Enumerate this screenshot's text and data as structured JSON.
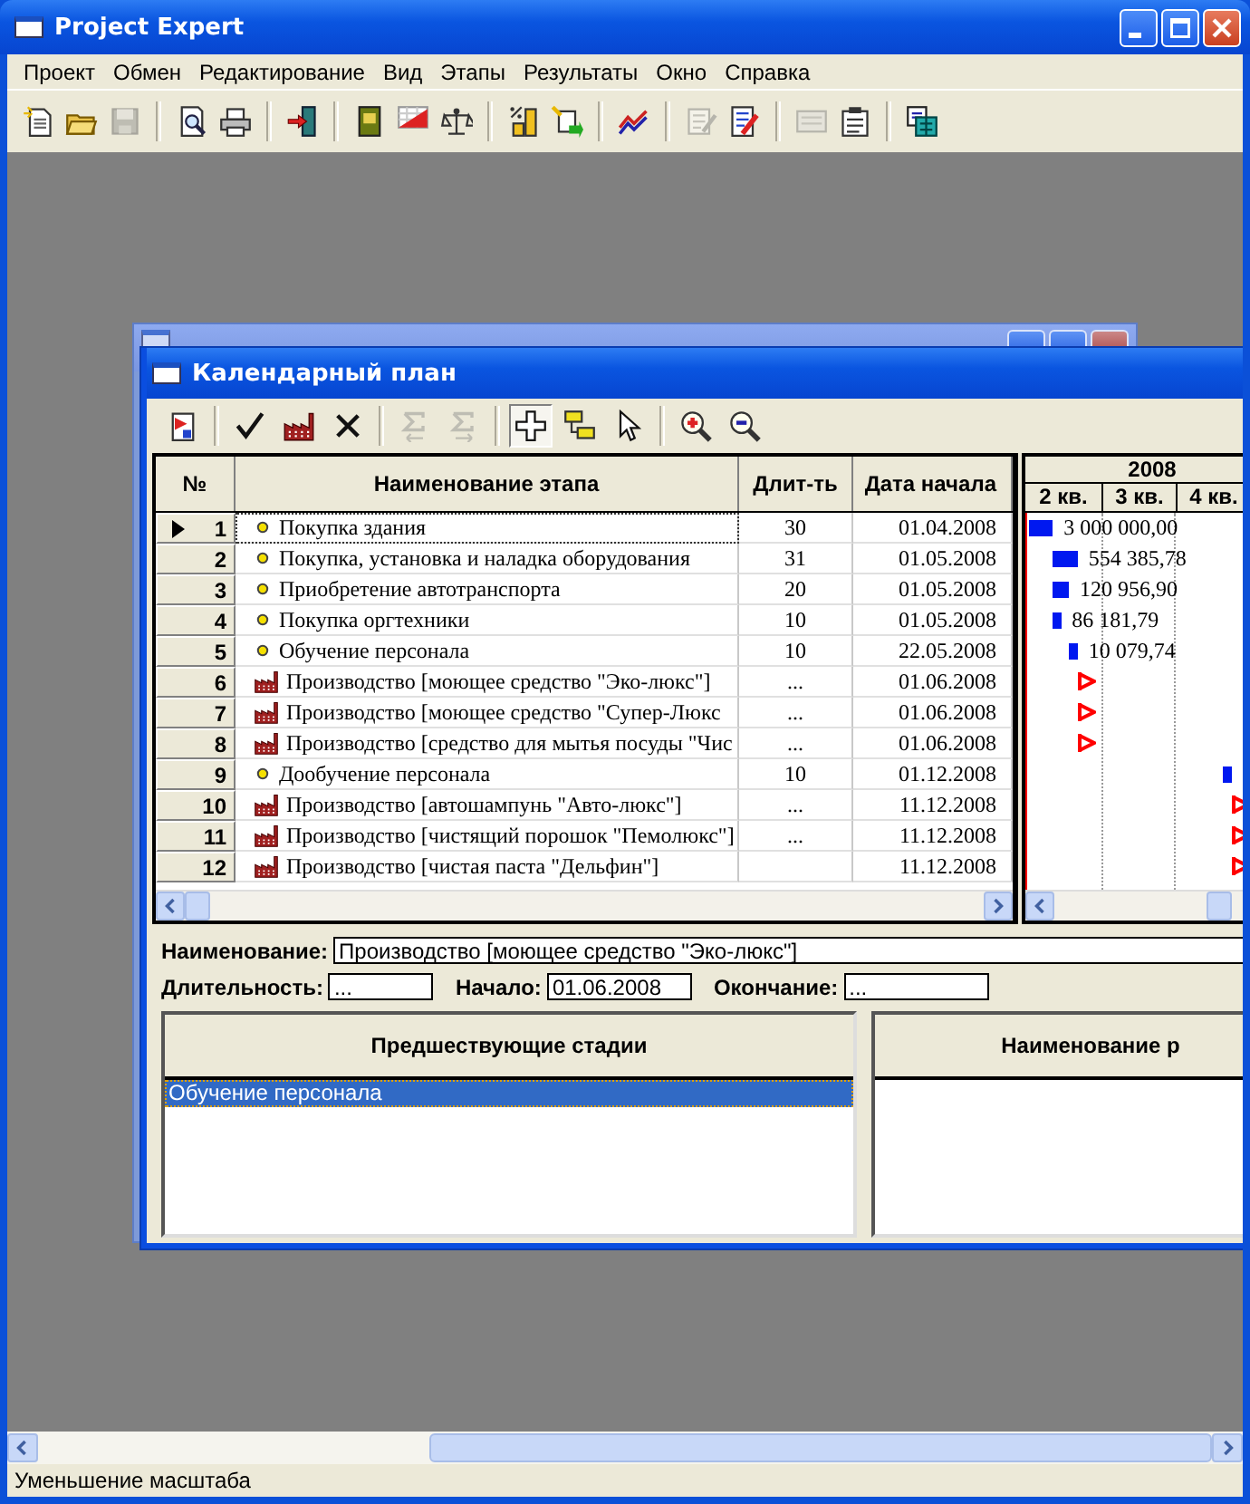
{
  "window": {
    "title": "Project Expert"
  },
  "menu": [
    "Проект",
    "Обмен",
    "Редактирование",
    "Вид",
    "Этапы",
    "Результаты",
    "Окно",
    "Справка"
  ],
  "toolbar": [
    {
      "kind": "new",
      "disabled": false
    },
    {
      "kind": "open",
      "disabled": false
    },
    {
      "kind": "save",
      "disabled": true
    },
    {
      "kind": "sep"
    },
    {
      "kind": "preview",
      "disabled": false
    },
    {
      "kind": "print",
      "disabled": false
    },
    {
      "kind": "sep"
    },
    {
      "kind": "exit",
      "disabled": false
    },
    {
      "kind": "sep"
    },
    {
      "kind": "book",
      "disabled": false
    },
    {
      "kind": "cf",
      "disabled": false
    },
    {
      "kind": "scales",
      "disabled": false
    },
    {
      "kind": "sep"
    },
    {
      "kind": "ruler",
      "disabled": false
    },
    {
      "kind": "import",
      "disabled": false
    },
    {
      "kind": "sep"
    },
    {
      "kind": "linechart",
      "disabled": false
    },
    {
      "kind": "sep"
    },
    {
      "kind": "report",
      "disabled": true
    },
    {
      "kind": "pen",
      "disabled": false
    },
    {
      "kind": "sep"
    },
    {
      "kind": "form",
      "disabled": true
    },
    {
      "kind": "clipboard",
      "disabled": false
    },
    {
      "kind": "sep"
    },
    {
      "kind": "calc",
      "disabled": false
    }
  ],
  "child_window": {
    "title": "Календарный план",
    "toolbar": [
      {
        "kind": "calendar",
        "disabled": false,
        "pressed": false
      },
      {
        "kind": "sep"
      },
      {
        "kind": "check",
        "disabled": false,
        "pressed": false
      },
      {
        "kind": "factory",
        "disabled": false,
        "pressed": false
      },
      {
        "kind": "delete",
        "disabled": false,
        "pressed": false
      },
      {
        "kind": "sep"
      },
      {
        "kind": "sigmaleft",
        "disabled": true,
        "pressed": false
      },
      {
        "kind": "sigmaright",
        "disabled": true,
        "pressed": false
      },
      {
        "kind": "sep"
      },
      {
        "kind": "plus",
        "disabled": false,
        "pressed": true
      },
      {
        "kind": "link",
        "disabled": false,
        "pressed": false
      },
      {
        "kind": "pointer",
        "disabled": false,
        "pressed": false
      },
      {
        "kind": "sep"
      },
      {
        "kind": "zoomin",
        "disabled": false,
        "pressed": false
      },
      {
        "kind": "zoomout",
        "disabled": false,
        "pressed": false
      }
    ],
    "table": {
      "columns": [
        "№",
        "Наименование этапа",
        "Длит-ть",
        "Дата начала"
      ],
      "rows": [
        {
          "number": "1",
          "kind": "stage",
          "name": "Покупка здания",
          "duration": "30",
          "start": "01.04.2008",
          "cost": "3 000 000,00",
          "current": true
        },
        {
          "number": "2",
          "kind": "stage",
          "name": "Покупка, установка и наладка оборудования",
          "duration": "31",
          "start": "01.05.2008",
          "cost": "554 385,78",
          "current": false
        },
        {
          "number": "3",
          "kind": "stage",
          "name": "Приобретение автотранспорта",
          "duration": "20",
          "start": "01.05.2008",
          "cost": "120 956,90",
          "current": false
        },
        {
          "number": "4",
          "kind": "stage",
          "name": "Покупка оргтехники",
          "duration": "10",
          "start": "01.05.2008",
          "cost": "86 181,79",
          "current": false
        },
        {
          "number": "5",
          "kind": "stage",
          "name": "Обучение персонала",
          "duration": "10",
          "start": "22.05.2008",
          "cost": "10 079,74",
          "current": false
        },
        {
          "number": "6",
          "kind": "production",
          "name": "Производство [моющее средство \"Эко-люкс\"]",
          "duration": "...",
          "start": "01.06.2008",
          "current": false
        },
        {
          "number": "7",
          "kind": "production",
          "name": "Производство [моющее средство \"Супер-Люкс",
          "duration": "...",
          "start": "01.06.2008",
          "current": false
        },
        {
          "number": "8",
          "kind": "production",
          "name": "Производство [средство для мытья посуды \"Чис",
          "duration": "...",
          "start": "01.06.2008",
          "current": false
        },
        {
          "number": "9",
          "kind": "stage",
          "name": "Дообучение персонала",
          "duration": "10",
          "start": "01.12.2008",
          "current": false
        },
        {
          "number": "10",
          "kind": "production",
          "name": "Производство [автошампунь \"Авто-люкс\"]",
          "duration": "...",
          "start": "11.12.2008",
          "current": false
        },
        {
          "number": "11",
          "kind": "production",
          "name": "Производство [чистящий порошок \"Пемолюкс\"]",
          "duration": "...",
          "start": "11.12.2008",
          "current": false
        },
        {
          "number": "12",
          "kind": "production",
          "name": "Производство [чистая паста \"Дельфин\"]",
          "start": "11.12.2008",
          "current": false
        }
      ]
    },
    "gantt": {
      "year": "2008",
      "quarters": [
        "2 кв.",
        "3 кв.",
        "4 кв."
      ]
    },
    "details": {
      "name_label": "Наименование:",
      "name": "Производство [моющее средство \"Эко-люкс\"]",
      "duration_label": "Длительность:",
      "duration": "...",
      "start_label": "Начало:",
      "start": "01.06.2008",
      "end_label": "Окончание:",
      "end": "..."
    },
    "predecessors": {
      "header": "Предшествующие стадии",
      "items": [
        {
          "label": "Обучение персонала",
          "selected": true
        }
      ]
    },
    "right_list": {
      "header": "Наименование р"
    }
  },
  "status_bar": "Уменьшение масштаба"
}
